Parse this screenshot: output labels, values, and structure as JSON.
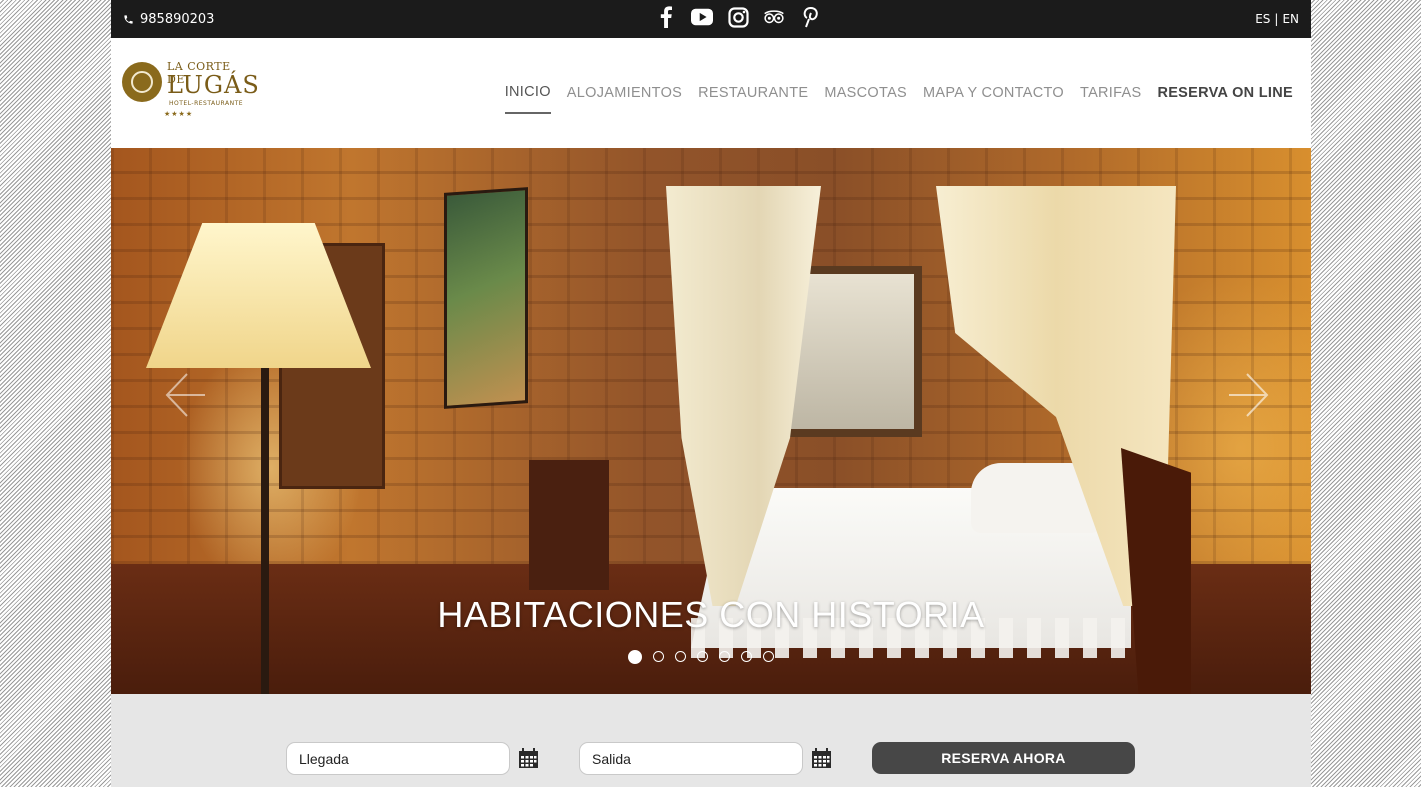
{
  "topbar": {
    "phone": "985890203",
    "social_icons": [
      "facebook-icon",
      "youtube-icon",
      "instagram-icon",
      "tripadvisor-icon",
      "pinterest-icon"
    ],
    "lang_es": "ES",
    "lang_sep": "|",
    "lang_en": "EN"
  },
  "logo": {
    "line1": "LA CORTE DE",
    "line2": "LUGÁS",
    "line3": "HOTEL-RESTAURANTE",
    "stars": "★★★★"
  },
  "nav": {
    "items": [
      {
        "label": "INICIO",
        "active": true
      },
      {
        "label": "ALOJAMIENTOS"
      },
      {
        "label": "RESTAURANTE"
      },
      {
        "label": "MASCOTAS"
      },
      {
        "label": "MAPA Y CONTACTO"
      },
      {
        "label": "TARIFAS"
      },
      {
        "label": "RESERVA ON LINE",
        "bold": true
      }
    ]
  },
  "hero": {
    "title": "HABITACIONES CON HISTORIA",
    "slide_count": 7,
    "active_slide": 1
  },
  "booking": {
    "arrival": "Llegada",
    "departure": "Salida",
    "button": "RESERVA AHORA"
  },
  "colors": {
    "topbar": "#1b1b1b",
    "booking_bg": "#e6e6e6",
    "button": "#474747",
    "logo_gold": "#8a6a1c"
  }
}
